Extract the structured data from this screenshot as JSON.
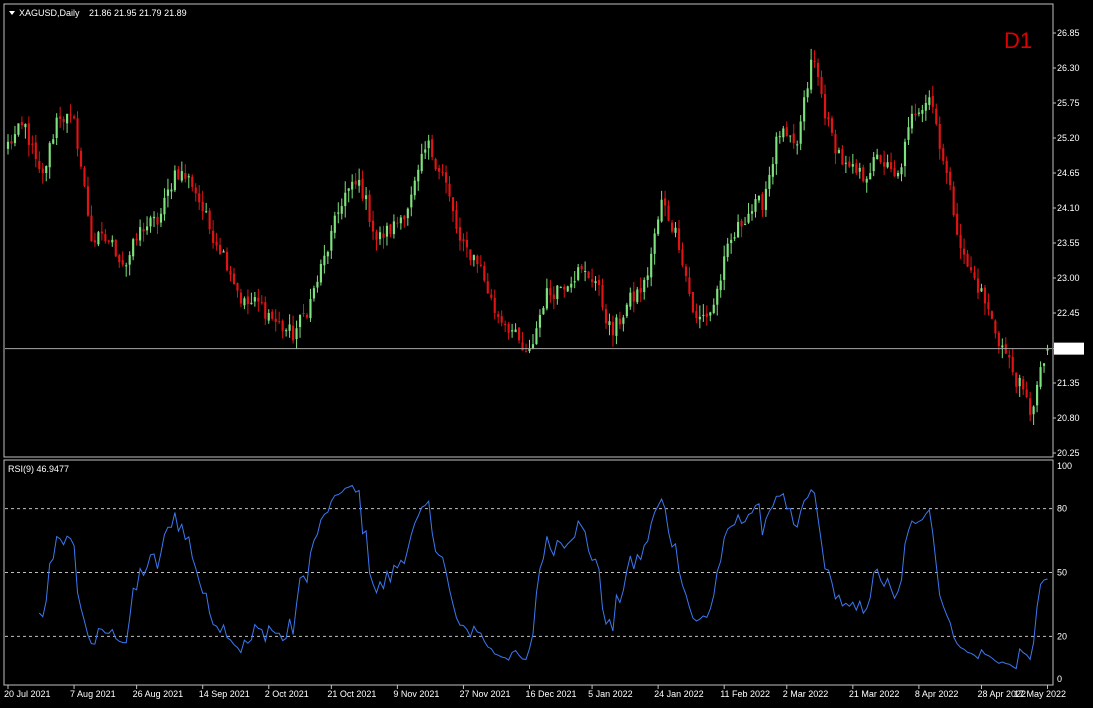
{
  "header": {
    "symbol_label": "XAGUSD,Daily",
    "ohlc": "21.86 21.95 21.79 21.89",
    "timeframe_badge": "D1"
  },
  "rsi_panel": {
    "label": "RSI(9) 46.9477"
  },
  "colors": {
    "background": "#000000",
    "grid_border": "#c0c0c0",
    "bull": "#7ee27e",
    "bear": "#e01414",
    "rsi_line": "#3c78f0",
    "price_line": "#a8a8a8",
    "timeframe": "#e00000"
  },
  "chart_data": [
    {
      "type": "candlestick",
      "symbol": "XAGUSD",
      "period": "Daily",
      "ylim": [
        20.25,
        26.85
      ],
      "yticks": [
        "26.85",
        "26.30",
        "25.75",
        "25.20",
        "24.65",
        "24.10",
        "23.55",
        "23.00",
        "22.45",
        "21.89",
        "21.35",
        "20.80",
        "20.25"
      ],
      "current_price": 21.89,
      "xticks": [
        "20 Jul 2021",
        "7 Aug 2021",
        "26 Aug 2021",
        "14 Sep 2021",
        "2 Oct 2021",
        "21 Oct 2021",
        "9 Nov 2021",
        "27 Nov 2021",
        "16 Dec 2021",
        "5 Jan 2022",
        "24 Jan 2022",
        "11 Feb 2022",
        "2 Mar 2022",
        "21 Mar 2022",
        "8 Apr 2022",
        "28 Apr 2022",
        "17 May 2022"
      ],
      "close_anchors": [
        25.1,
        25.4,
        24.5,
        25.6,
        25.4,
        23.6,
        23.6,
        23.2,
        23.8,
        23.9,
        24.7,
        24.5,
        23.8,
        23.3,
        22.6,
        22.6,
        22.3,
        22.1,
        22.6,
        23.4,
        24.3,
        24.5,
        23.6,
        23.8,
        24.2,
        25.1,
        24.6,
        23.5,
        23.3,
        22.5,
        22.2,
        21.7,
        22.7,
        22.9,
        23.1,
        23.0,
        22.1,
        22.6,
        22.9,
        24.2,
        23.6,
        22.3,
        22.5,
        23.5,
        24.0,
        24.2,
        25.3,
        25.0,
        26.5,
        25.3,
        24.7,
        24.6,
        24.9,
        24.5,
        25.6,
        25.9,
        24.6,
        23.3,
        22.8,
        22.1,
        21.5,
        20.9,
        21.89
      ],
      "ohlc": []
    },
    {
      "type": "line",
      "name": "RSI(9)",
      "ylim": [
        0,
        100
      ],
      "yticks": [
        "100",
        "80",
        "50",
        "20",
        "0"
      ],
      "levels": [
        80,
        50,
        20
      ],
      "last_value": 46.9477,
      "values": []
    }
  ]
}
